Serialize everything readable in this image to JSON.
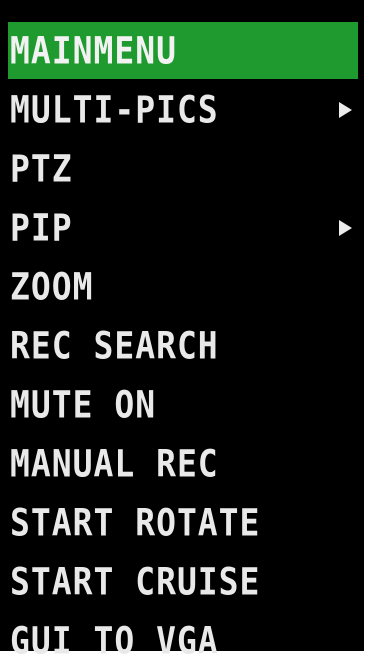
{
  "menu": {
    "items": [
      {
        "label": "MAINMENU",
        "selected": true,
        "has_submenu": false
      },
      {
        "label": "MULTI-PICS",
        "selected": false,
        "has_submenu": true
      },
      {
        "label": "PTZ",
        "selected": false,
        "has_submenu": false
      },
      {
        "label": "PIP",
        "selected": false,
        "has_submenu": true
      },
      {
        "label": "ZOOM",
        "selected": false,
        "has_submenu": false
      },
      {
        "label": "REC SEARCH",
        "selected": false,
        "has_submenu": false
      },
      {
        "label": "MUTE ON",
        "selected": false,
        "has_submenu": false
      },
      {
        "label": "MANUAL REC",
        "selected": false,
        "has_submenu": false
      },
      {
        "label": "START ROTATE",
        "selected": false,
        "has_submenu": false
      },
      {
        "label": "START CRUISE",
        "selected": false,
        "has_submenu": false
      },
      {
        "label": "GUI TO VGA",
        "selected": false,
        "has_submenu": false
      }
    ]
  },
  "colors": {
    "background": "#000000",
    "selected_highlight": "#1f9a2e",
    "text": "#e9e9e9"
  },
  "icons": {
    "submenu": "right-triangle-arrow"
  }
}
